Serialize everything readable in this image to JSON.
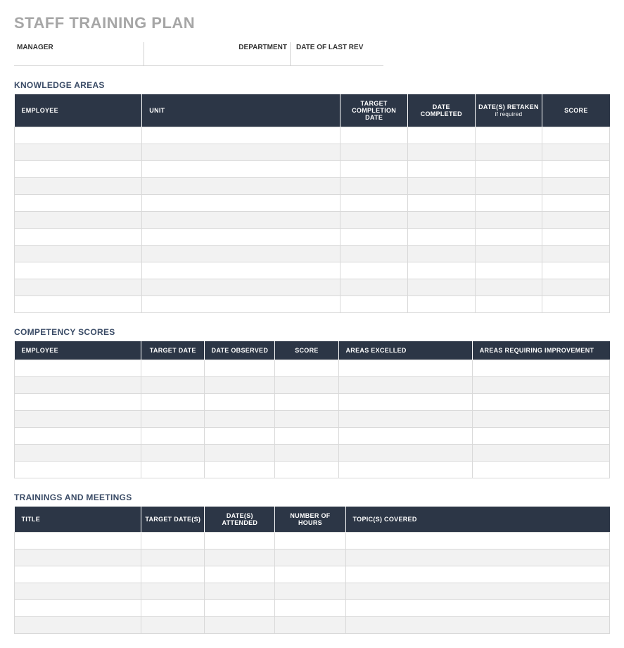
{
  "title": "STAFF TRAINING PLAN",
  "meta": {
    "manager_label": "MANAGER",
    "department_label": "DEPARTMENT",
    "date_last_rev_label": "DATE OF LAST REV",
    "manager_value": "",
    "department_value": "",
    "date_last_rev_value": ""
  },
  "sections": {
    "knowledge": {
      "heading": "KNOWLEDGE AREAS",
      "columns": {
        "employee": "EMPLOYEE",
        "unit": "UNIT",
        "target_completion": "TARGET COMPLETION DATE",
        "date_completed": "DATE COMPLETED",
        "dates_retaken": "DATE(S) RETAKEN",
        "dates_retaken_sub": "if required",
        "score": "SCORE"
      },
      "rows": [
        {
          "employee": "",
          "unit": "",
          "target": "",
          "completed": "",
          "retaken": "",
          "score": ""
        },
        {
          "employee": "",
          "unit": "",
          "target": "",
          "completed": "",
          "retaken": "",
          "score": ""
        },
        {
          "employee": "",
          "unit": "",
          "target": "",
          "completed": "",
          "retaken": "",
          "score": ""
        },
        {
          "employee": "",
          "unit": "",
          "target": "",
          "completed": "",
          "retaken": "",
          "score": ""
        },
        {
          "employee": "",
          "unit": "",
          "target": "",
          "completed": "",
          "retaken": "",
          "score": ""
        },
        {
          "employee": "",
          "unit": "",
          "target": "",
          "completed": "",
          "retaken": "",
          "score": ""
        },
        {
          "employee": "",
          "unit": "",
          "target": "",
          "completed": "",
          "retaken": "",
          "score": ""
        },
        {
          "employee": "",
          "unit": "",
          "target": "",
          "completed": "",
          "retaken": "",
          "score": ""
        },
        {
          "employee": "",
          "unit": "",
          "target": "",
          "completed": "",
          "retaken": "",
          "score": ""
        },
        {
          "employee": "",
          "unit": "",
          "target": "",
          "completed": "",
          "retaken": "",
          "score": ""
        },
        {
          "employee": "",
          "unit": "",
          "target": "",
          "completed": "",
          "retaken": "",
          "score": ""
        }
      ]
    },
    "competency": {
      "heading": "COMPETENCY SCORES",
      "columns": {
        "employee": "EMPLOYEE",
        "target_date": "TARGET DATE",
        "date_observed": "DATE OBSERVED",
        "score": "SCORE",
        "areas_excelled": "AREAS EXCELLED",
        "areas_improve": "AREAS REQUIRING IMPROVEMENT"
      },
      "rows": [
        {
          "employee": "",
          "target": "",
          "observed": "",
          "score": "",
          "excelled": "",
          "improve": ""
        },
        {
          "employee": "",
          "target": "",
          "observed": "",
          "score": "",
          "excelled": "",
          "improve": ""
        },
        {
          "employee": "",
          "target": "",
          "observed": "",
          "score": "",
          "excelled": "",
          "improve": ""
        },
        {
          "employee": "",
          "target": "",
          "observed": "",
          "score": "",
          "excelled": "",
          "improve": ""
        },
        {
          "employee": "",
          "target": "",
          "observed": "",
          "score": "",
          "excelled": "",
          "improve": ""
        },
        {
          "employee": "",
          "target": "",
          "observed": "",
          "score": "",
          "excelled": "",
          "improve": ""
        },
        {
          "employee": "",
          "target": "",
          "observed": "",
          "score": "",
          "excelled": "",
          "improve": ""
        }
      ]
    },
    "trainings": {
      "heading": "TRAININGS AND MEETINGS",
      "columns": {
        "title": "TITLE",
        "target_dates": "TARGET DATE(S)",
        "dates_attended": "DATE(S) ATTENDED",
        "hours": "NUMBER OF HOURS",
        "topics": "TOPIC(S) COVERED"
      },
      "rows": [
        {
          "title": "",
          "target": "",
          "attended": "",
          "hours": "",
          "topics": ""
        },
        {
          "title": "",
          "target": "",
          "attended": "",
          "hours": "",
          "topics": ""
        },
        {
          "title": "",
          "target": "",
          "attended": "",
          "hours": "",
          "topics": ""
        },
        {
          "title": "",
          "target": "",
          "attended": "",
          "hours": "",
          "topics": ""
        },
        {
          "title": "",
          "target": "",
          "attended": "",
          "hours": "",
          "topics": ""
        },
        {
          "title": "",
          "target": "",
          "attended": "",
          "hours": "",
          "topics": ""
        }
      ]
    }
  }
}
